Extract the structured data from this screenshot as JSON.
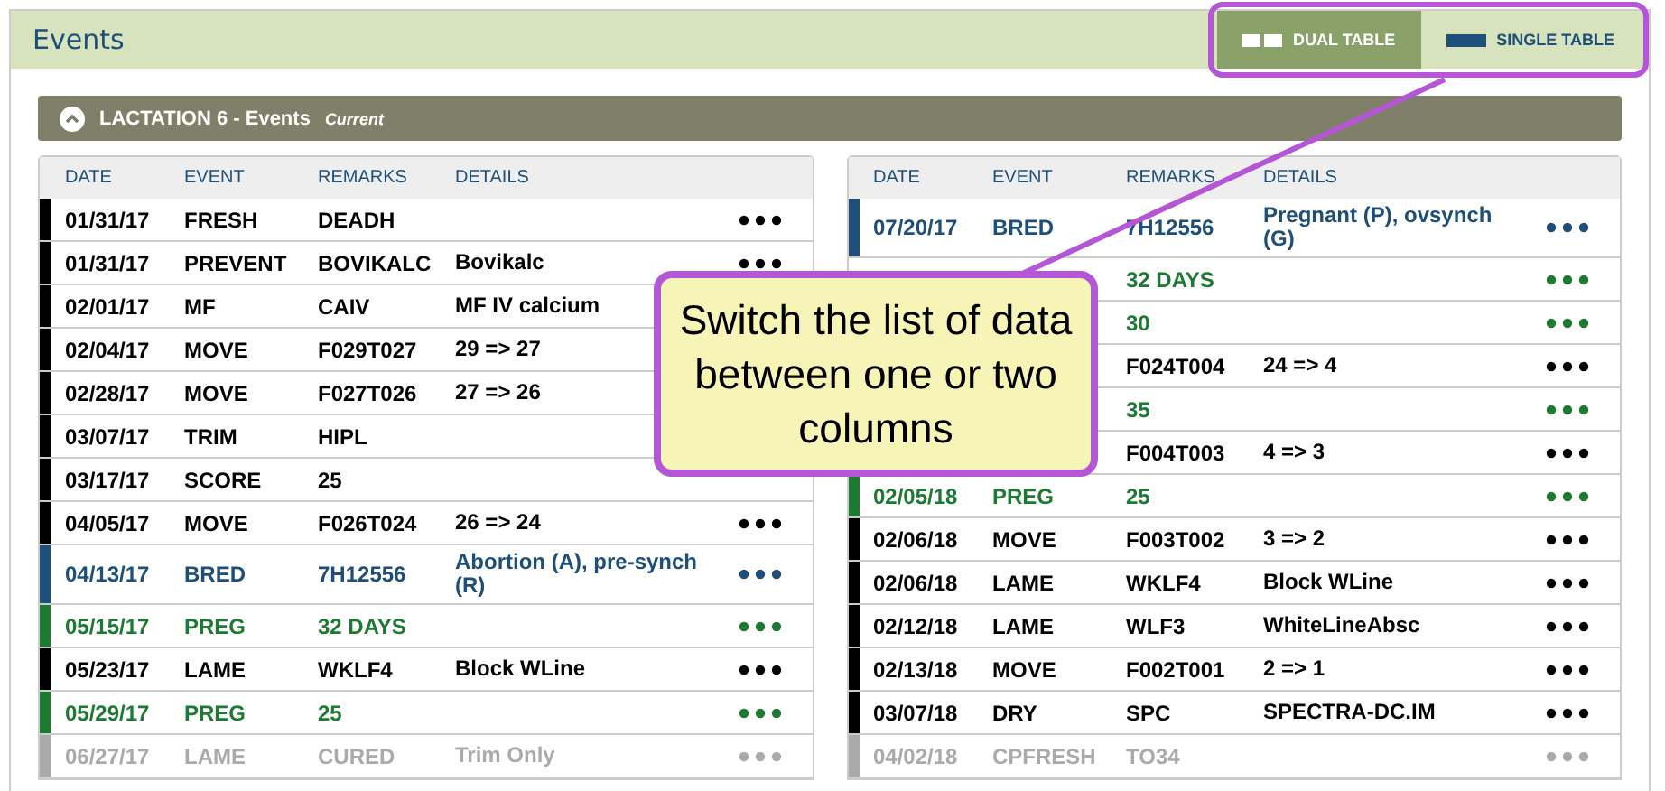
{
  "header": {
    "title": "Events",
    "toggle": [
      {
        "label": "DUAL TABLE",
        "kind": "dual",
        "selected": true
      },
      {
        "label": "SINGLE TABLE",
        "kind": "single",
        "selected": false
      }
    ]
  },
  "lactation": {
    "title": "LACTATION 6 - Events",
    "status": "Current"
  },
  "tables": [
    {
      "columns": [
        "DATE",
        "EVENT",
        "REMARKS",
        "DETAILS"
      ],
      "rows": [
        {
          "date": "01/31/17",
          "event": "FRESH",
          "remarks": "DEADH",
          "color": "#000000",
          "menu": true
        },
        {
          "date": "01/31/17",
          "event": "PREVENT",
          "remarks": "BOVIKALC",
          "details": "Bovikalc",
          "color": "#000000",
          "menu": true
        },
        {
          "date": "02/01/17",
          "event": "MF",
          "remarks": "CAIV",
          "details": "MF IV calcium",
          "color": "#000000",
          "menu": false
        },
        {
          "date": "02/04/17",
          "event": "MOVE",
          "remarks": "F029T027",
          "details": "29 => 27",
          "color": "#000000",
          "menu": false
        },
        {
          "date": "02/28/17",
          "event": "MOVE",
          "remarks": "F027T026",
          "details": "27 => 26",
          "color": "#000000",
          "menu": false
        },
        {
          "date": "03/07/17",
          "event": "TRIM",
          "remarks": "HIPL",
          "color": "#000000",
          "menu": false
        },
        {
          "date": "03/17/17",
          "event": "SCORE",
          "remarks": "25",
          "color": "#000000",
          "menu": false
        },
        {
          "date": "04/05/17",
          "event": "MOVE",
          "remarks": "F026T024",
          "details": "26 => 24",
          "color": "#000000",
          "menu": true
        },
        {
          "date": "04/13/17",
          "event": "BRED",
          "remarks": "7H12556",
          "details": "Abortion (A), pre-synch (R)",
          "color": "#1e4f7a",
          "menu": true
        },
        {
          "date": "05/15/17",
          "event": "PREG",
          "remarks": "32 DAYS",
          "color": "#1d7a32",
          "menu": true
        },
        {
          "date": "05/23/17",
          "event": "LAME",
          "remarks": "WKLF4",
          "details": "Block WLine",
          "color": "#000000",
          "menu": true
        },
        {
          "date": "05/29/17",
          "event": "PREG",
          "remarks": "25",
          "color": "#1d7a32",
          "menu": true
        },
        {
          "date": "06/27/17",
          "event": "LAME",
          "remarks": "CURED",
          "details": "Trim Only",
          "color": "#aaaaaa",
          "menu": true
        }
      ]
    },
    {
      "columns": [
        "DATE",
        "EVENT",
        "REMARKS",
        "DETAILS"
      ],
      "rows": [
        {
          "date": "07/20/17",
          "event": "BRED",
          "remarks": "7H12556",
          "details": "Pregnant (P), ovsynch (G)",
          "color": "#1e4f7a",
          "menu": true
        },
        {
          "remarks": "32 DAYS",
          "color": "#1d7a32",
          "menu": true
        },
        {
          "remarks": "30",
          "color": "#1d7a32",
          "menu": true
        },
        {
          "remarks": "F024T004",
          "details": "24 => 4",
          "color": "#000000",
          "menu": true
        },
        {
          "remarks": "35",
          "color": "#1d7a32",
          "menu": true
        },
        {
          "remarks": "F004T003",
          "details": "4 => 3",
          "color": "#000000",
          "menu": true
        },
        {
          "date": "02/05/18",
          "event": "PREG",
          "remarks": "25",
          "color": "#1d7a32",
          "menu": true
        },
        {
          "date": "02/06/18",
          "event": "MOVE",
          "remarks": "F003T002",
          "details": "3 => 2",
          "color": "#000000",
          "menu": true
        },
        {
          "date": "02/06/18",
          "event": "LAME",
          "remarks": "WKLF4",
          "details": "Block WLine",
          "color": "#000000",
          "menu": true
        },
        {
          "date": "02/12/18",
          "event": "LAME",
          "remarks": "WLF3",
          "details": "WhiteLineAbsc",
          "color": "#000000",
          "menu": true
        },
        {
          "date": "02/13/18",
          "event": "MOVE",
          "remarks": "F002T001",
          "details": "2 => 1",
          "color": "#000000",
          "menu": true
        },
        {
          "date": "03/07/18",
          "event": "DRY",
          "remarks": "SPC",
          "details": "SPECTRA-DC.IM",
          "color": "#000000",
          "menu": true
        },
        {
          "date": "04/02/18",
          "event": "CPFRESH",
          "remarks": "TO34",
          "color": "#aaaaaa",
          "menu": true
        }
      ]
    }
  ],
  "callout": {
    "text": "Switch the list of data between one or two columns"
  }
}
